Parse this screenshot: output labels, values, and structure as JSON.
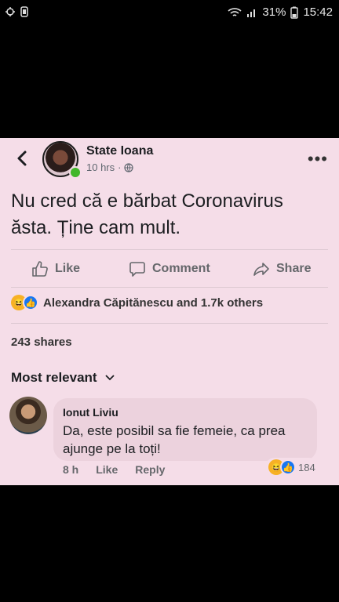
{
  "status_bar": {
    "battery": "31%",
    "time": "15:42"
  },
  "post": {
    "author": "State Ioana",
    "time": "10 hrs",
    "text": "Nu cred că e bărbat Coronavirus ăsta. Ține cam mult.",
    "actions": {
      "like": "Like",
      "comment": "Comment",
      "share": "Share"
    },
    "reactions_text": "Alexandra Căpitănescu and 1.7k others",
    "shares": "243 shares",
    "sort_label": "Most relevant"
  },
  "comment": {
    "author": "Ionut Liviu",
    "text": "Da, este posibil sa fie femeie, ca prea ajunge pe la toți!",
    "time": "8 h",
    "like": "Like",
    "reply": "Reply",
    "reaction_count": "184"
  },
  "icons": [
    "back-icon",
    "globe-icon",
    "more-icon",
    "like-icon",
    "comment-icon",
    "share-icon",
    "haha-icon",
    "thumb-icon",
    "chevron-down-icon",
    "wifi-icon",
    "signal-icon",
    "battery-icon"
  ],
  "colors": {
    "panel": "#f5dde8",
    "like_blue": "#1877f2",
    "online": "#42b72a"
  }
}
